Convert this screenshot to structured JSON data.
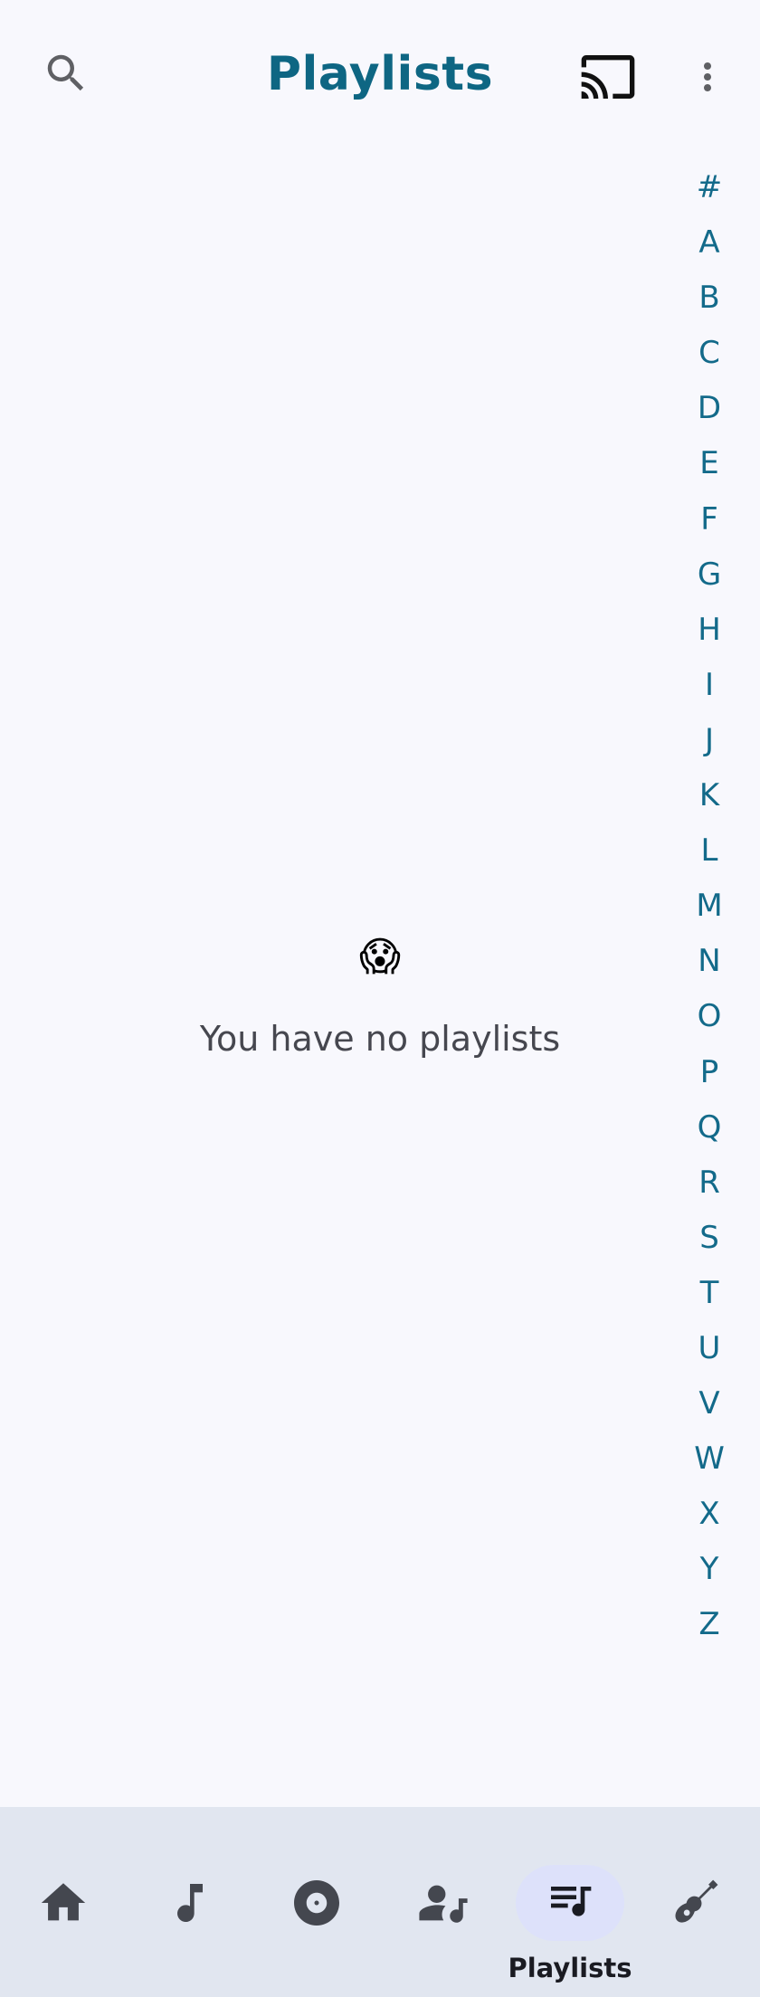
{
  "header": {
    "title": "Playlists",
    "search_icon": "search-icon",
    "cast_icon": "cast-icon",
    "more_icon": "more-vert-icon"
  },
  "alphabet_index": [
    "#",
    "A",
    "B",
    "C",
    "D",
    "E",
    "F",
    "G",
    "H",
    "I",
    "J",
    "K",
    "L",
    "M",
    "N",
    "O",
    "P",
    "Q",
    "R",
    "S",
    "T",
    "U",
    "V",
    "W",
    "X",
    "Y",
    "Z"
  ],
  "empty_state": {
    "emoji": "😱",
    "message": "You have no playlists"
  },
  "bottom_nav": {
    "selected": "playlists",
    "items": [
      {
        "id": "home",
        "icon": "home-icon"
      },
      {
        "id": "songs",
        "icon": "music-note-icon"
      },
      {
        "id": "albums",
        "icon": "album-icon"
      },
      {
        "id": "artists",
        "icon": "artist-icon"
      },
      {
        "id": "playlists",
        "icon": "queue-music-icon",
        "label": "Playlists"
      },
      {
        "id": "genres",
        "icon": "guitar-icon"
      }
    ]
  },
  "colors": {
    "accent": "#0e6683",
    "background": "#f8f8fd",
    "nav_background": "#e1e6f0",
    "selected_pill": "#dde1fa",
    "icon_dark": "#44474f"
  }
}
